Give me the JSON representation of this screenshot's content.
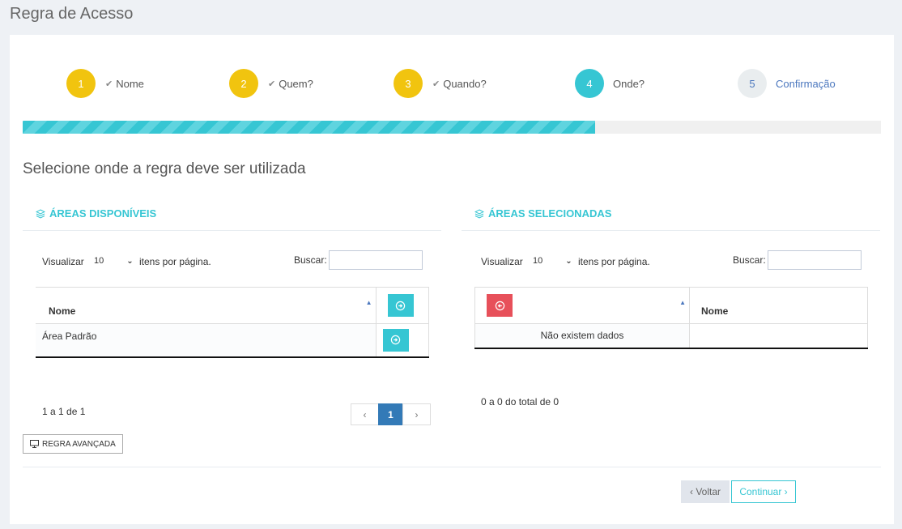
{
  "page_title": "Regra de Acesso",
  "steps": [
    {
      "number": "1",
      "label": "Nome",
      "state": "done"
    },
    {
      "number": "2",
      "label": "Quem?",
      "state": "done"
    },
    {
      "number": "3",
      "label": "Quando?",
      "state": "done"
    },
    {
      "number": "4",
      "label": "Onde?",
      "state": "active"
    },
    {
      "number": "5",
      "label": "Confirmação",
      "state": "todo"
    }
  ],
  "progress_fraction": 0.667,
  "section_title": "Selecione onde a regra deve ser utilizada",
  "available": {
    "title": "ÁREAS DISPONÍVEIS",
    "visualizar": "Visualizar",
    "page_size": "10",
    "itens_por_pagina": "itens por página.",
    "buscar": "Buscar:",
    "search_value": "",
    "col_nome": "Nome",
    "rows": [
      "Área Padrão"
    ],
    "info": "1 a 1 de 1",
    "pager": {
      "prev": "‹",
      "current": "1",
      "next": "›"
    }
  },
  "selected": {
    "title": "ÁREAS SELECIONADAS",
    "visualizar": "Visualizar",
    "page_size": "10",
    "itens_por_pagina": "itens por página.",
    "buscar": "Buscar:",
    "search_value": "",
    "col_nome": "Nome",
    "empty": "Não existem dados",
    "info": "0 a 0 do total de 0"
  },
  "advanced_button": "REGRA AVANÇADA",
  "back_button": "‹ Voltar",
  "continue_button": "Continuar ›"
}
